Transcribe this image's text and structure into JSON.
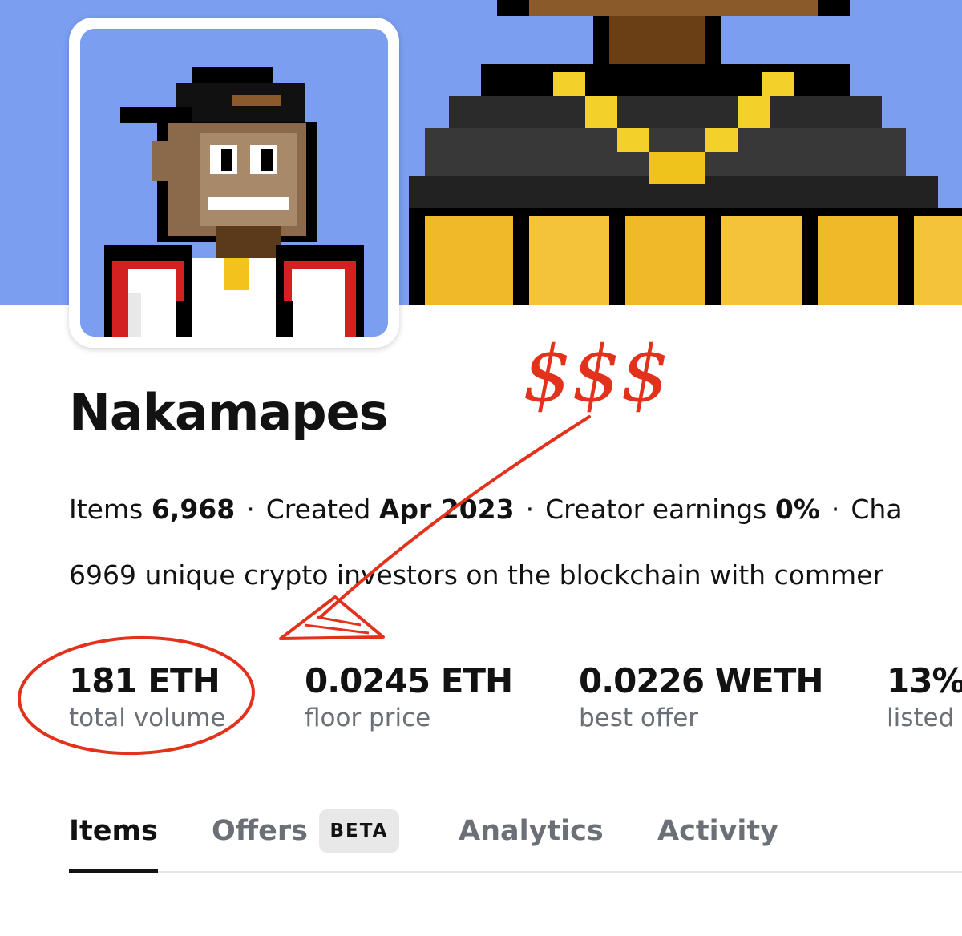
{
  "collection": {
    "name": "Nakamapes",
    "meta": [
      {
        "label": "Items",
        "value": "6,968"
      },
      {
        "label": "Created",
        "value": "Apr 2023"
      },
      {
        "label": "Creator earnings",
        "value": "0%"
      },
      {
        "label": "Cha",
        "value": ""
      }
    ],
    "description": "6969 unique crypto investors on the blockchain with commer"
  },
  "stats": [
    {
      "value": "181 ETH",
      "label": "total volume"
    },
    {
      "value": "0.0245 ETH",
      "label": "floor price"
    },
    {
      "value": "0.0226 WETH",
      "label": "best offer"
    },
    {
      "value": "13%",
      "label": "listed"
    }
  ],
  "tabs": [
    {
      "label": "Items",
      "active": true
    },
    {
      "label": "Offers",
      "badge": "BETA"
    },
    {
      "label": "Analytics"
    },
    {
      "label": "Activity"
    }
  ],
  "annotation": {
    "text": "$$$",
    "color": "#e2321c"
  },
  "colors": {
    "banner_bg": "#7b9ef0",
    "text_primary": "#121212",
    "text_secondary": "#6b6f76"
  }
}
